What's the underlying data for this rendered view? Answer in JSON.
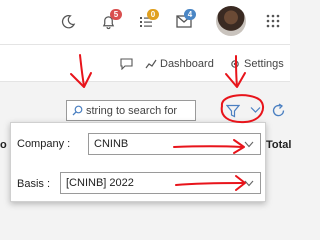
{
  "header": {
    "icons": [
      "moon-icon",
      "bell-icon",
      "tasks-icon",
      "mail-icon",
      "grid-icon"
    ],
    "badges": {
      "notifications": "5",
      "tasks": "0",
      "messages": "4"
    },
    "badge_colors": {
      "notifications": "#d94f4f",
      "tasks": "#e0a020",
      "messages": "#4a86c5"
    }
  },
  "toolbar": {
    "dashboard_label": "Dashboard",
    "settings_label": "Settings"
  },
  "search": {
    "placeholder": "string to search for"
  },
  "filter_panel": {
    "company_label": "Company :",
    "company_value": "CNINB",
    "basis_label": "Basis :",
    "basis_value": "[CNINB] 2022"
  },
  "background_text": {
    "left_fragment": "o",
    "right_fragment": "Total"
  },
  "annotation_color": "#e8141b"
}
